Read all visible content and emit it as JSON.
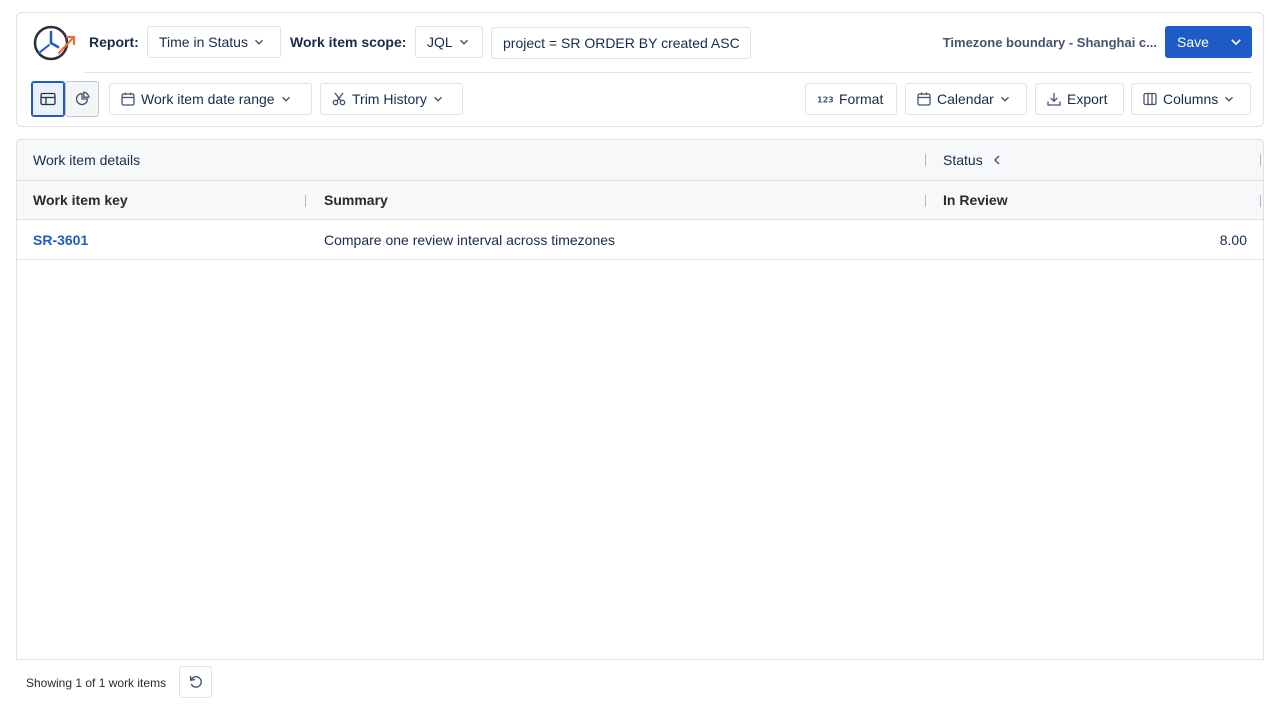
{
  "header": {
    "report_label": "Report:",
    "report_type": "Time in Status",
    "scope_label": "Work item scope:",
    "scope_type": "JQL",
    "jql_query": "project = SR ORDER BY created ASC",
    "report_name": "Timezone boundary - Shanghai c...",
    "save_label": "Save"
  },
  "toolbar": {
    "date_range_label": "Work item date range",
    "trim_history_label": "Trim History",
    "format_label": "Format",
    "calendar_label": "Calendar",
    "export_label": "Export",
    "columns_label": "Columns"
  },
  "table": {
    "group_headers": {
      "details": "Work item details",
      "status": "Status"
    },
    "columns": {
      "key": "Work item key",
      "summary": "Summary",
      "status_column": "In Review"
    },
    "rows": [
      {
        "key": "SR-3601",
        "summary": "Compare one review interval across timezones",
        "in_review": "8.00"
      }
    ]
  },
  "footer": {
    "showing_text": "Showing 1 of 1 work items"
  },
  "colors": {
    "accent": "#1f5bc7",
    "border": "#dfe1e6",
    "text": "#172b4d"
  }
}
